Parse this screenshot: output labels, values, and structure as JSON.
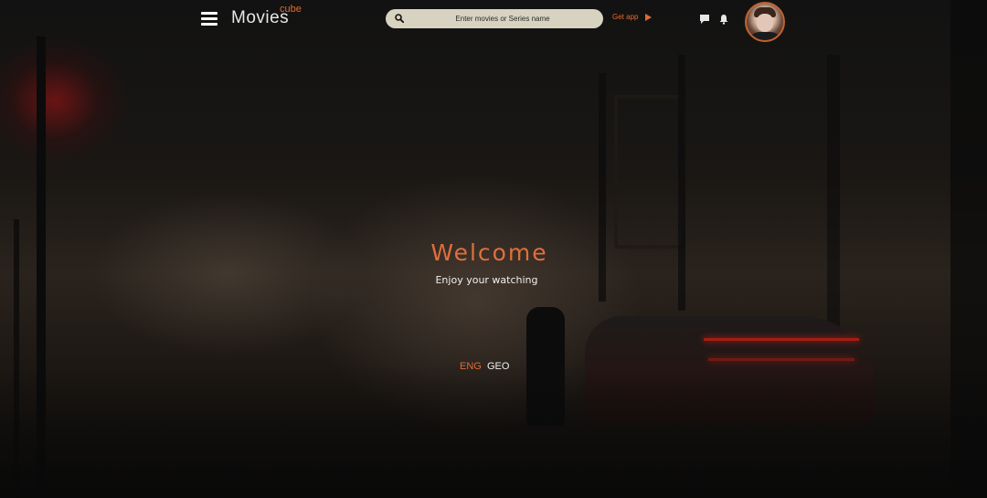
{
  "header": {
    "logo_text": "Movies",
    "logo_superscript": "cube",
    "search_placeholder": "Enter movies or Series name",
    "get_app_label": "Get app",
    "icons": [
      "menu-icon",
      "search-icon",
      "play-icon",
      "chat-icon",
      "bell-icon"
    ]
  },
  "hero": {
    "title": "Welcome",
    "subtitle": "Enjoy your watching"
  },
  "languages": {
    "eng": "ENG",
    "geo": "GEO",
    "active": "ENG"
  },
  "colors": {
    "accent": "#e06a33",
    "search_bg": "#d7d3c0",
    "text_light": "#f0f0f0"
  }
}
